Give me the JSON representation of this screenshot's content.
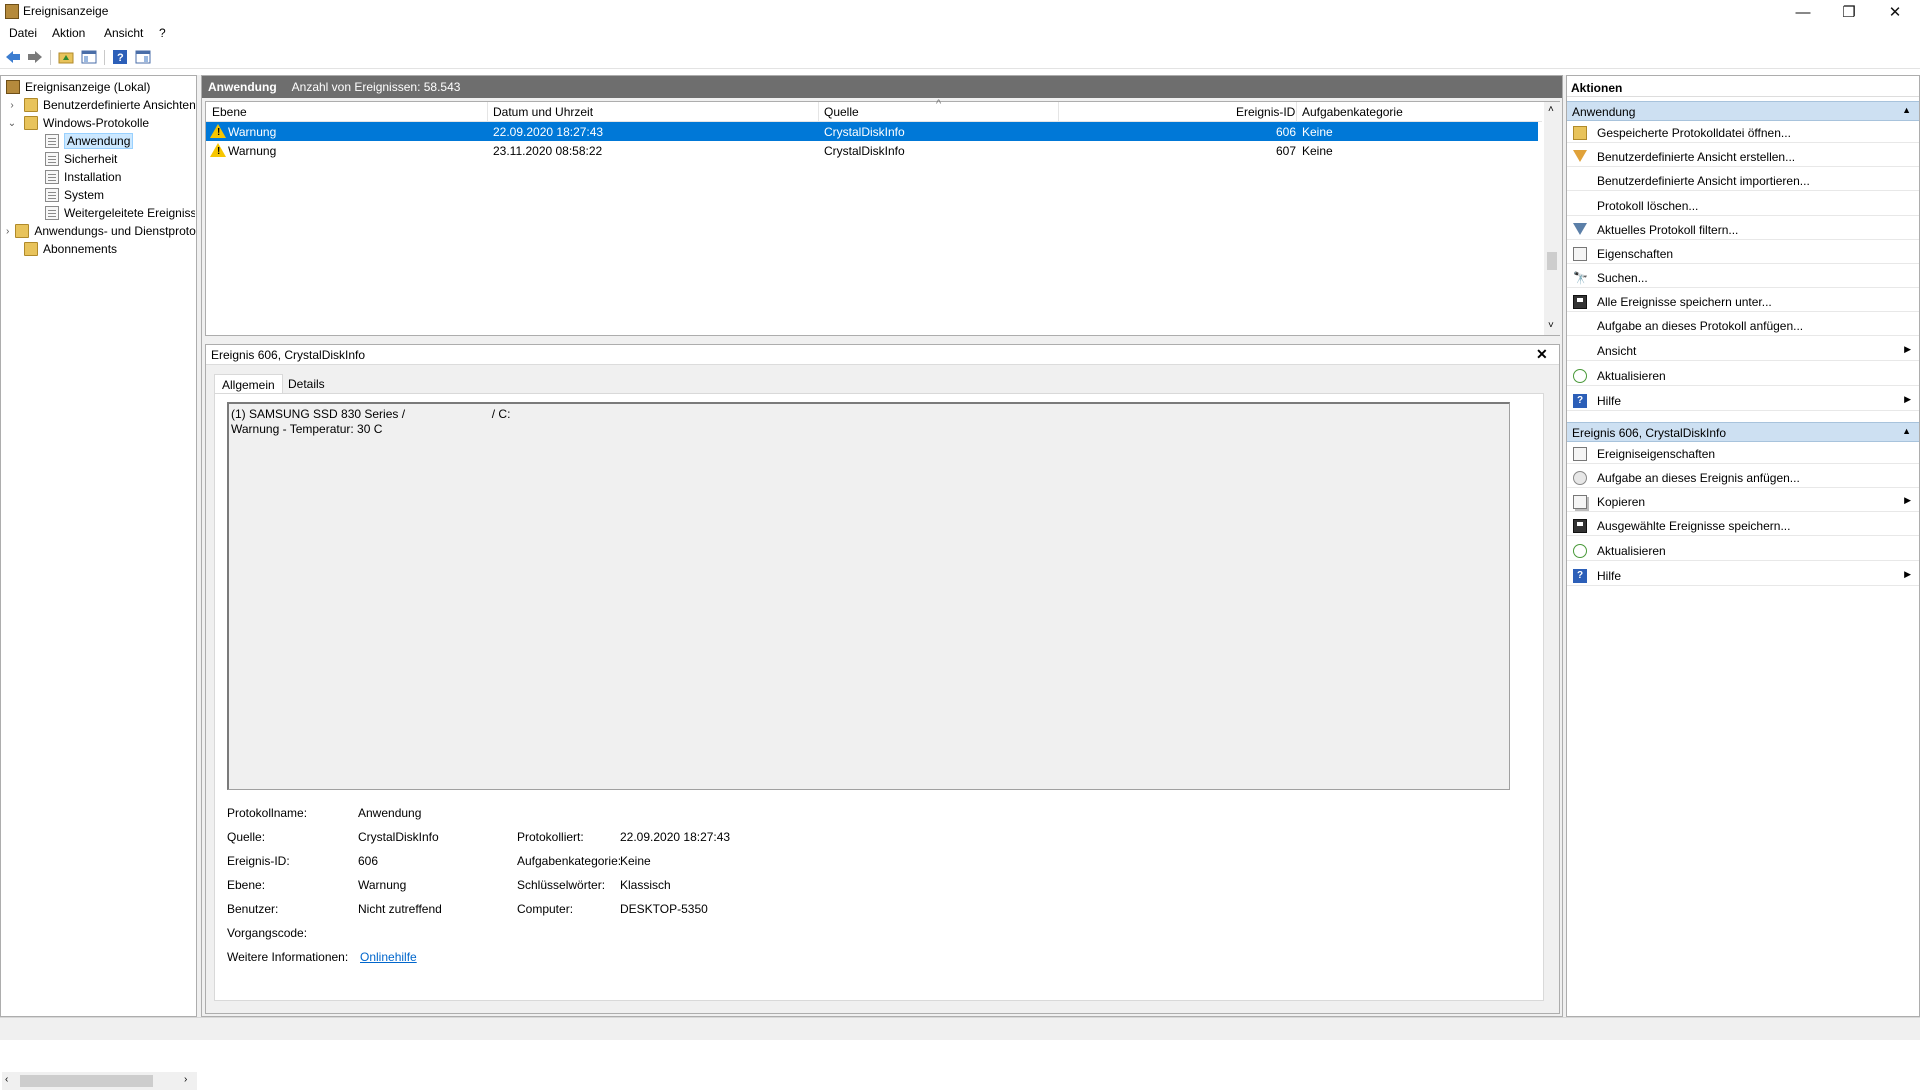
{
  "window": {
    "title": "Ereignisanzeige",
    "controls": [
      "—",
      "❐",
      "✕"
    ]
  },
  "menu": [
    {
      "label": "D",
      "rest": "atei"
    },
    {
      "label": "A",
      "rest": "ktion",
      "underline_index": 1
    },
    {
      "label": "A",
      "rest": "nsicht"
    },
    {
      "label": "?",
      "rest": ""
    }
  ],
  "menu_plain": [
    "Datei",
    "Aktion",
    "Ansicht",
    "?"
  ],
  "toolbar": {
    "icons": [
      "back-icon",
      "forward-icon",
      "up-folder-icon",
      "show-hide-console-tree-icon",
      "help-icon",
      "show-hide-action-pane-icon"
    ]
  },
  "tree": {
    "items": [
      {
        "label": "Ereignisanzeige (Lokal)",
        "icon": "event-viewer-icon",
        "depth": 0,
        "expander": ""
      },
      {
        "label": "Benutzerdefinierte Ansichten",
        "icon": "folder-icon",
        "depth": 1,
        "expander": "›"
      },
      {
        "label": "Windows-Protokolle",
        "icon": "folder-icon",
        "depth": 1,
        "expander": "⌄"
      },
      {
        "label": "Anwendung",
        "icon": "log-icon",
        "depth": 2,
        "expander": "",
        "selected": true
      },
      {
        "label": "Sicherheit",
        "icon": "log-icon",
        "depth": 2,
        "expander": ""
      },
      {
        "label": "Installation",
        "icon": "log-icon",
        "depth": 2,
        "expander": ""
      },
      {
        "label": "System",
        "icon": "log-icon",
        "depth": 2,
        "expander": ""
      },
      {
        "label": "Weitergeleitete Ereignisse",
        "icon": "log-icon",
        "depth": 2,
        "expander": ""
      },
      {
        "label": "Anwendungs- und Dienstprotokolle",
        "icon": "folder-icon",
        "depth": 1,
        "expander": "›"
      },
      {
        "label": "Abonnements",
        "icon": "folder-icon",
        "depth": 1,
        "expander": ""
      }
    ]
  },
  "list": {
    "title": "Anwendung",
    "count_text": "Anzahl von Ereignissen: 58.543",
    "columns": [
      "Ebene",
      "Datum und Uhrzeit",
      "Quelle",
      "Ereignis-ID",
      "Aufgabenkategorie"
    ],
    "sort_indicator": "^",
    "rows": [
      {
        "level": "Warnung",
        "date": "22.09.2020 18:27:43",
        "source": "CrystalDiskInfo",
        "id": "606",
        "category": "Keine",
        "selected": true
      },
      {
        "level": "Warnung",
        "date": "23.11.2020 08:58:22",
        "source": "CrystalDiskInfo",
        "id": "607",
        "category": "Keine",
        "selected": false
      }
    ]
  },
  "detail": {
    "header": "Ereignis 606, CrystalDiskInfo",
    "tabs": [
      "Allgemein",
      "Details"
    ],
    "description": "(1) SAMSUNG SSD 830 Series /                          / C:\nWarnung - Temperatur: 30 C",
    "labels": {
      "log_name": "Protokollname:",
      "source": "Quelle:",
      "event_id": "Ereignis-ID:",
      "level": "Ebene:",
      "user": "Benutzer:",
      "opcode": "Vorgangscode:",
      "more_info": "Weitere Informationen:",
      "logged": "Protokolliert:",
      "task_category": "Aufgabenkategorie:",
      "keywords": "Schlüsselwörter:",
      "computer": "Computer:"
    },
    "values": {
      "log_name": "Anwendung",
      "source": "CrystalDiskInfo",
      "event_id": "606",
      "level": "Warnung",
      "user": "Nicht zutreffend",
      "opcode": "",
      "more_info": "Onlinehilfe",
      "logged": "22.09.2020 18:27:43",
      "task_category": "Keine",
      "keywords": "Klassisch",
      "computer": "DESKTOP-5350"
    }
  },
  "actions": {
    "title": "Aktionen",
    "sections": [
      {
        "header": "Anwendung",
        "items": [
          {
            "label": "Gespeicherte Protokolldatei öffnen...",
            "icon": "open-log-icon"
          },
          {
            "label": "Benutzerdefinierte Ansicht erstellen...",
            "icon": "create-view-icon"
          },
          {
            "label": "Benutzerdefinierte Ansicht importieren...",
            "icon": ""
          },
          {
            "label": "Protokoll löschen...",
            "icon": ""
          },
          {
            "label": "Aktuelles Protokoll filtern...",
            "icon": "filter-icon"
          },
          {
            "label": "Eigenschaften",
            "icon": "properties-icon"
          },
          {
            "label": "Suchen...",
            "icon": "find-icon"
          },
          {
            "label": "Alle Ereignisse speichern unter...",
            "icon": "save-icon"
          },
          {
            "label": "Aufgabe an dieses Protokoll anfügen...",
            "icon": ""
          },
          {
            "label": "Ansicht",
            "icon": "",
            "submenu": true
          },
          {
            "label": "Aktualisieren",
            "icon": "refresh-icon"
          },
          {
            "label": "Hilfe",
            "icon": "help-icon",
            "submenu": true
          }
        ]
      },
      {
        "header": "Ereignis 606, CrystalDiskInfo",
        "items": [
          {
            "label": "Ereigniseigenschaften",
            "icon": "event-properties-icon"
          },
          {
            "label": "Aufgabe an dieses Ereignis anfügen...",
            "icon": "attach-task-icon"
          },
          {
            "label": "Kopieren",
            "icon": "copy-icon",
            "submenu": true
          },
          {
            "label": "Ausgewählte Ereignisse speichern...",
            "icon": "save-icon"
          },
          {
            "label": "Aktualisieren",
            "icon": "refresh-icon"
          },
          {
            "label": "Hilfe",
            "icon": "help-icon",
            "submenu": true
          }
        ]
      }
    ]
  },
  "colors": {
    "selection": "#0078d7",
    "section_header": "#cde0f2",
    "list_header": "#6e6e6e",
    "link": "#0066cc",
    "warning": "#f7c600"
  }
}
